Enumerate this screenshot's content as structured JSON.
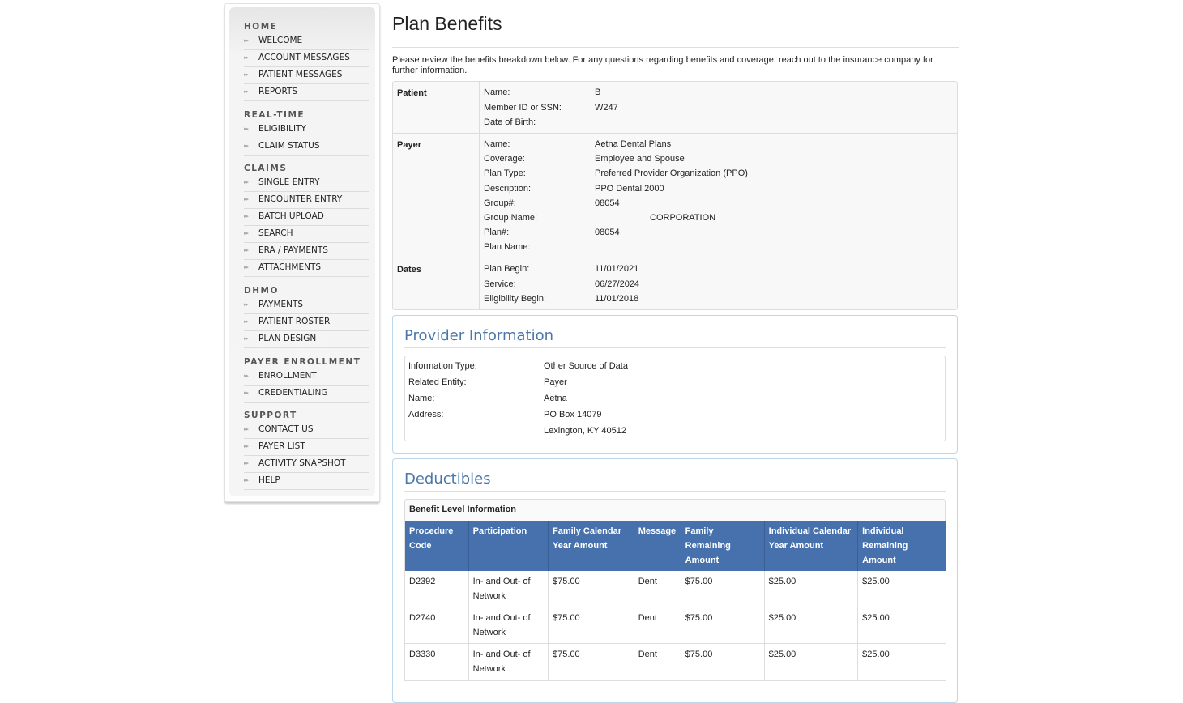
{
  "sidebar": {
    "sections": [
      {
        "heading": "HOME",
        "items": [
          "WELCOME",
          "ACCOUNT MESSAGES",
          "PATIENT MESSAGES",
          "REPORTS"
        ]
      },
      {
        "heading": "REAL-TIME",
        "items": [
          "ELIGIBILITY",
          "CLAIM STATUS"
        ]
      },
      {
        "heading": "CLAIMS",
        "items": [
          "SINGLE ENTRY",
          "ENCOUNTER ENTRY",
          "BATCH UPLOAD",
          "SEARCH",
          "ERA / PAYMENTS",
          "ATTACHMENTS"
        ]
      },
      {
        "heading": "DHMO",
        "items": [
          "PAYMENTS",
          "PATIENT ROSTER",
          "PLAN DESIGN"
        ]
      },
      {
        "heading": "PAYER ENROLLMENT",
        "items": [
          "ENROLLMENT",
          "CREDENTIALING"
        ]
      },
      {
        "heading": "SUPPORT",
        "items": [
          "CONTACT US",
          "PAYER LIST",
          "ACTIVITY SNAPSHOT",
          "HELP"
        ]
      }
    ],
    "item_icon": "double-chevron-right-icon"
  },
  "main": {
    "title": "Plan Benefits",
    "intro": "Please review the benefits breakdown below. For any questions regarding benefits and coverage, reach out to the insurance company for further information.",
    "patient": {
      "label": "Patient",
      "rows": [
        {
          "k": "Name:",
          "v": "B"
        },
        {
          "k": "Member ID or SSN:",
          "v": "W247"
        },
        {
          "k": "Date of Birth:",
          "v": ""
        }
      ]
    },
    "payer": {
      "label": "Payer",
      "rows": [
        {
          "k": "Name:",
          "v": "Aetna Dental Plans"
        },
        {
          "k": "Coverage:",
          "v": "Employee and Spouse"
        },
        {
          "k": "Plan Type:",
          "v": "Preferred Provider Organization (PPO)"
        },
        {
          "k": "Description:",
          "v": "PPO Dental 2000"
        },
        {
          "k": "Group#:",
          "v": "08054"
        },
        {
          "k": "Group Name:",
          "v": "CORPORATION"
        },
        {
          "k": "Plan#:",
          "v": "08054"
        },
        {
          "k": "Plan Name:",
          "v": ""
        }
      ]
    },
    "dates": {
      "label": "Dates",
      "rows": [
        {
          "k": "Plan Begin:",
          "v": "11/01/2021"
        },
        {
          "k": "Service:",
          "v": "06/27/2024"
        },
        {
          "k": "Eligibility Begin:",
          "v": "11/01/2018"
        }
      ]
    },
    "provider": {
      "title": "Provider Information",
      "rows": [
        {
          "k": "Information Type:",
          "v": "Other Source of Data"
        },
        {
          "k": "Related Entity:",
          "v": "Payer"
        },
        {
          "k": "Name:",
          "v": "Aetna"
        },
        {
          "k": "Address:",
          "v": "PO Box 14079"
        },
        {
          "k": "",
          "v": "Lexington, KY 40512"
        }
      ]
    },
    "deductibles": {
      "title": "Deductibles",
      "caption": "Benefit Level Information",
      "headers": [
        "Procedure Code",
        "Participation",
        "Family Calendar Year Amount",
        "Message",
        "Family Remaining Amount",
        "Individual Calendar Year Amount",
        "Individual Remaining Amount"
      ],
      "rows": [
        [
          "D2392",
          "In- and Out- of Network",
          "$75.00",
          "Dent",
          "$75.00",
          "$25.00",
          "$25.00"
        ],
        [
          "D2740",
          "In- and Out- of Network",
          "$75.00",
          "Dent",
          "$75.00",
          "$25.00",
          "$25.00"
        ],
        [
          "D3330",
          "In- and Out- of Network",
          "$75.00",
          "Dent",
          "$75.00",
          "$25.00",
          "$25.00"
        ]
      ]
    }
  },
  "colors": {
    "table_header_bg": "#4671ad",
    "panel_title": "#4a77a8",
    "panel_border": "#bcd6ec"
  }
}
